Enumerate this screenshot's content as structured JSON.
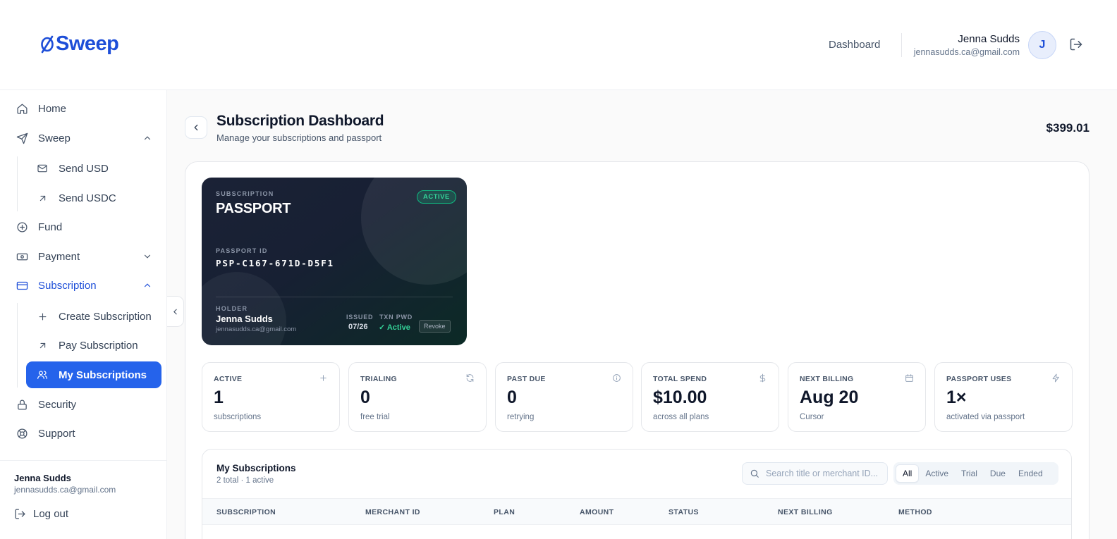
{
  "brand": {
    "name": "Sweep",
    "accent": "#1d4ed8"
  },
  "header": {
    "nav_link": "Dashboard",
    "user_name": "Jenna Sudds",
    "user_email": "jennasudds.ca@gmail.com",
    "avatar_initial": "J"
  },
  "sidebar": {
    "items": [
      {
        "label": "Home"
      },
      {
        "label": "Sweep"
      },
      {
        "label": "Send USD"
      },
      {
        "label": "Send USDC"
      },
      {
        "label": "Fund"
      },
      {
        "label": "Payment"
      },
      {
        "label": "Subscription"
      },
      {
        "label": "Create Subscription"
      },
      {
        "label": "Pay Subscription"
      },
      {
        "label": "My Subscriptions"
      },
      {
        "label": "Security"
      },
      {
        "label": "Support"
      }
    ],
    "footer": {
      "name": "Jenna Sudds",
      "email": "jennasudds.ca@gmail.com",
      "logout": "Log out"
    }
  },
  "page": {
    "title": "Subscription Dashboard",
    "subtitle": "Manage your subscriptions and passport",
    "balance": "$399.01"
  },
  "passport": {
    "kicker": "SUBSCRIPTION",
    "title": "PASSPORT",
    "status": "ACTIVE",
    "id_label": "PASSPORT ID",
    "id": "PSP-C167-671D-D5F1",
    "holder_label": "HOLDER",
    "holder_name": "Jenna Sudds",
    "holder_email": "jennasudds.ca@gmail.com",
    "issued_label": "ISSUED",
    "issued": "07/26",
    "txn_label": "TXN PWD",
    "txn_status": "✓ Active",
    "revoke": "Revoke"
  },
  "stats": [
    {
      "label": "ACTIVE",
      "value": "1",
      "sub": "subscriptions",
      "icon": "plus-icon"
    },
    {
      "label": "TRIALING",
      "value": "0",
      "sub": "free trial",
      "icon": "refresh-icon"
    },
    {
      "label": "PAST DUE",
      "value": "0",
      "sub": "retrying",
      "icon": "info-icon"
    },
    {
      "label": "TOTAL SPEND",
      "value": "$10.00",
      "sub": "across all plans",
      "icon": "dollar-icon"
    },
    {
      "label": "NEXT BILLING",
      "value": "Aug 20",
      "sub": "Cursor",
      "icon": "calendar-icon"
    },
    {
      "label": "PASSPORT USES",
      "value": "1×",
      "sub": "activated via passport",
      "icon": "bolt-icon"
    }
  ],
  "subscriptions": {
    "title": "My Subscriptions",
    "count": "2 total · 1 active",
    "search_placeholder": "Search title or merchant ID...",
    "filters": [
      "All",
      "Active",
      "Trial",
      "Due",
      "Ended"
    ],
    "selected_filter": "All",
    "columns": [
      "SUBSCRIPTION",
      "MERCHANT ID",
      "PLAN",
      "AMOUNT",
      "STATUS",
      "NEXT BILLING",
      "METHOD"
    ]
  }
}
